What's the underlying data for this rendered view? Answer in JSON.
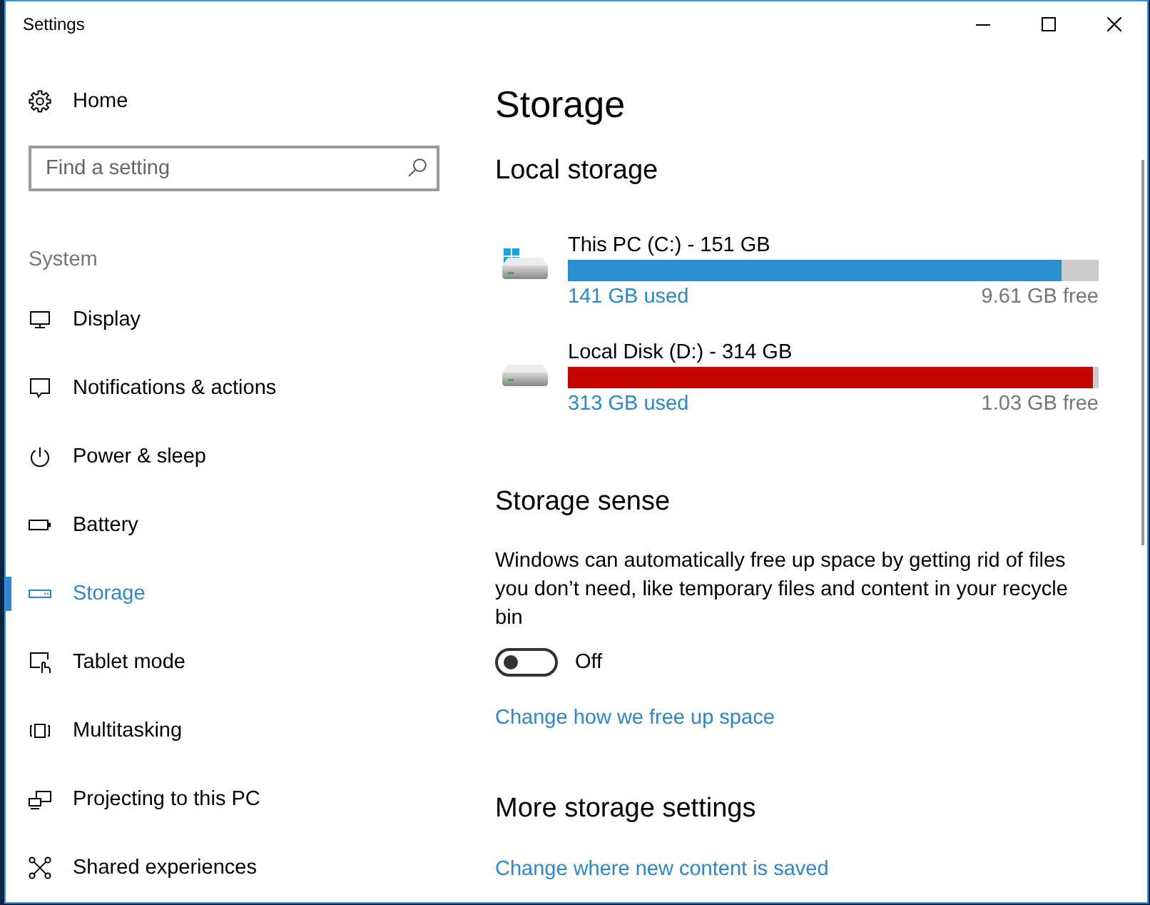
{
  "window": {
    "title": "Settings"
  },
  "sidebar": {
    "home": "Home",
    "search": {
      "placeholder": "Find a setting"
    },
    "group": "System",
    "items": [
      {
        "kind": "display",
        "label": "Display",
        "selected": false
      },
      {
        "kind": "notifications",
        "label": "Notifications & actions",
        "selected": false
      },
      {
        "kind": "power",
        "label": "Power & sleep",
        "selected": false
      },
      {
        "kind": "battery",
        "label": "Battery",
        "selected": false
      },
      {
        "kind": "storage",
        "label": "Storage",
        "selected": true
      },
      {
        "kind": "tablet",
        "label": "Tablet mode",
        "selected": false
      },
      {
        "kind": "multitasking",
        "label": "Multitasking",
        "selected": false
      },
      {
        "kind": "projecting",
        "label": "Projecting to this PC",
        "selected": false
      },
      {
        "kind": "shared",
        "label": "Shared experiences",
        "selected": false
      }
    ]
  },
  "page": {
    "title": "Storage",
    "local_storage": {
      "heading": "Local storage",
      "drives": [
        {
          "kind": "system",
          "name": "This PC (C:) - 151 GB",
          "level": 0.93,
          "color": "#2a8fd0",
          "used": "141 GB used",
          "free": "9.61 GB free"
        },
        {
          "kind": "data",
          "name": "Local Disk (D:) - 314 GB",
          "level": 0.99,
          "color": "#c50500",
          "used": "313 GB used",
          "free": "1.03 GB free"
        }
      ]
    },
    "storage_sense": {
      "heading": "Storage sense",
      "description": "Windows can automatically free up space by getting rid of files you don’t need, like temporary files and content in your recycle bin",
      "toggle": {
        "on": false,
        "label": "Off"
      },
      "link": "Change how we free up space"
    },
    "more_settings": {
      "heading": "More storage settings",
      "links": [
        "Change where new content is saved"
      ]
    }
  }
}
